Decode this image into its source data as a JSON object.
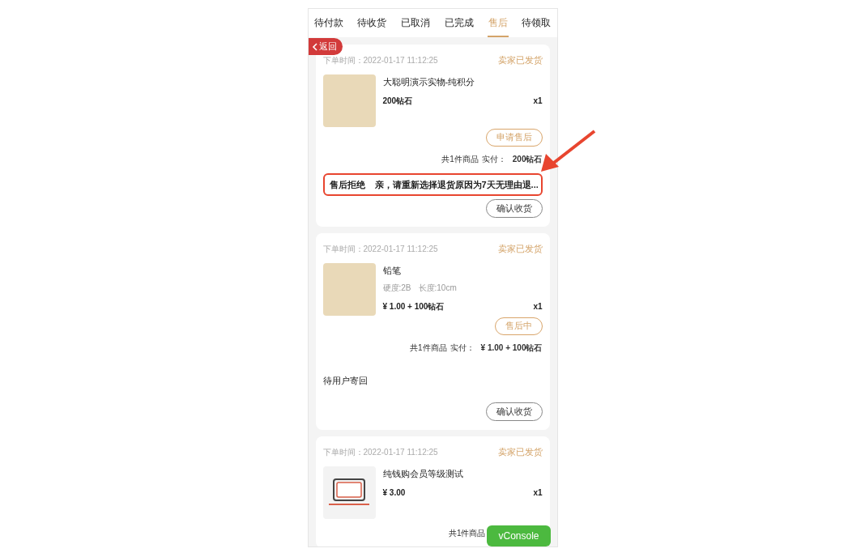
{
  "tabs": [
    {
      "label": "待付款",
      "selected": false
    },
    {
      "label": "待收货",
      "selected": false
    },
    {
      "label": "已取消",
      "selected": false
    },
    {
      "label": "已完成",
      "selected": false
    },
    {
      "label": "售后",
      "selected": true
    },
    {
      "label": "待领取",
      "selected": false
    }
  ],
  "back_button": {
    "label": "返回"
  },
  "orders": [
    {
      "time_label": "下单时间：",
      "time": "2022-01-17 11:12:25",
      "status": "卖家已发货",
      "product": {
        "kind": "photo",
        "name": "大聪明演示实物-纯积分",
        "price": "200钻石",
        "qty": "x1"
      },
      "action_button": {
        "label": "申请售后"
      },
      "total": {
        "count": "共1件商品",
        "paid_label": "实付：",
        "amount": "200钻石"
      },
      "note": {
        "status": "售后拒绝",
        "message": "亲，请重新选择退货原因为7天无理由退...",
        "highlighted": true
      },
      "confirm_button": {
        "label": "确认收货"
      }
    },
    {
      "time_label": "下单时间：",
      "time": "2022-01-17 11:12:25",
      "status": "卖家已发货",
      "product": {
        "kind": "photo",
        "name": "铅笔",
        "specs": [
          "硬度:2B",
          "长度:10cm"
        ],
        "price": "¥ 1.00 + 100钻石",
        "qty": "x1"
      },
      "action_button": {
        "label": "售后中"
      },
      "total": {
        "count": "共1件商品",
        "paid_label": "实付：",
        "amount": "¥ 1.00 + 100钻石"
      },
      "note": {
        "status": "待用户寄回",
        "highlighted": false
      },
      "confirm_button": {
        "label": "确认收货"
      }
    },
    {
      "time_label": "下单时间：",
      "time": "2022-01-17 11:12:25",
      "status": "卖家已发货",
      "product": {
        "kind": "laptop",
        "name": "纯钱购会员等级测试",
        "price": "¥ 3.00",
        "qty": "x1"
      },
      "total": {
        "count": "共1件商品"
      }
    }
  ],
  "console_button": {
    "label": "vConsole"
  }
}
